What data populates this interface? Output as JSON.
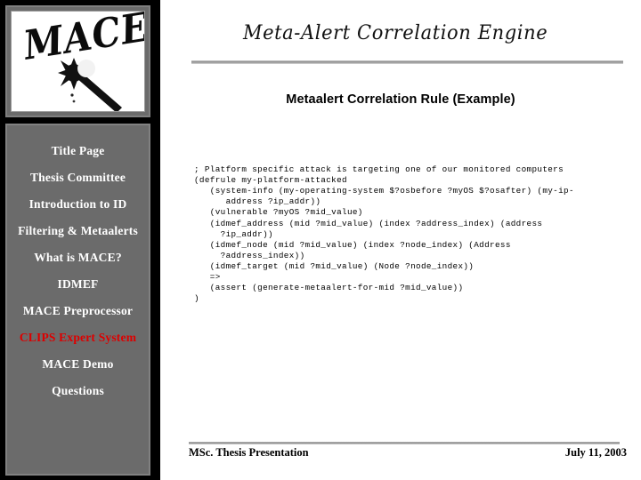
{
  "sidebar": {
    "logo": {
      "word": "MACE",
      "icon": "mace-weapon-icon"
    },
    "items": [
      {
        "label": "Title Page",
        "active": false
      },
      {
        "label": "Thesis Committee",
        "active": false
      },
      {
        "label": "Introduction to ID",
        "active": false
      },
      {
        "label": "Filtering & Metaalerts",
        "active": false
      },
      {
        "label": "What is MACE?",
        "active": false
      },
      {
        "label": "IDMEF",
        "active": false
      },
      {
        "label": "MACE Preprocessor",
        "active": false
      },
      {
        "label": "CLIPS Expert System",
        "active": true
      },
      {
        "label": "MACE Demo",
        "active": false
      },
      {
        "label": "Questions",
        "active": false
      }
    ],
    "active_color": "#dd0000",
    "panel_color": "#6b6b6b",
    "text_color": "#ffffff"
  },
  "header": {
    "title": "Meta-Alert Correlation Engine"
  },
  "main": {
    "slide_title": "Metaalert Correlation Rule (Example)",
    "code": "; Platform specific attack is targeting one of our monitored computers\n(defrule my-platform-attacked\n   (system-info (my-operating-system $?osbefore ?myOS $?osafter) (my-ip-\n      address ?ip_addr))\n   (vulnerable ?myOS ?mid_value)\n   (idmef_address (mid ?mid_value) (index ?address_index) (address\n     ?ip_addr))\n   (idmef_node (mid ?mid_value) (index ?node_index) (Address\n     ?address_index))\n   (idmef_target (mid ?mid_value) (Node ?node_index))\n   =>\n   (assert (generate-metaalert-for-mid ?mid_value))\n)"
  },
  "footer": {
    "left": "MSc. Thesis Presentation",
    "right": "July 11, 2003"
  }
}
